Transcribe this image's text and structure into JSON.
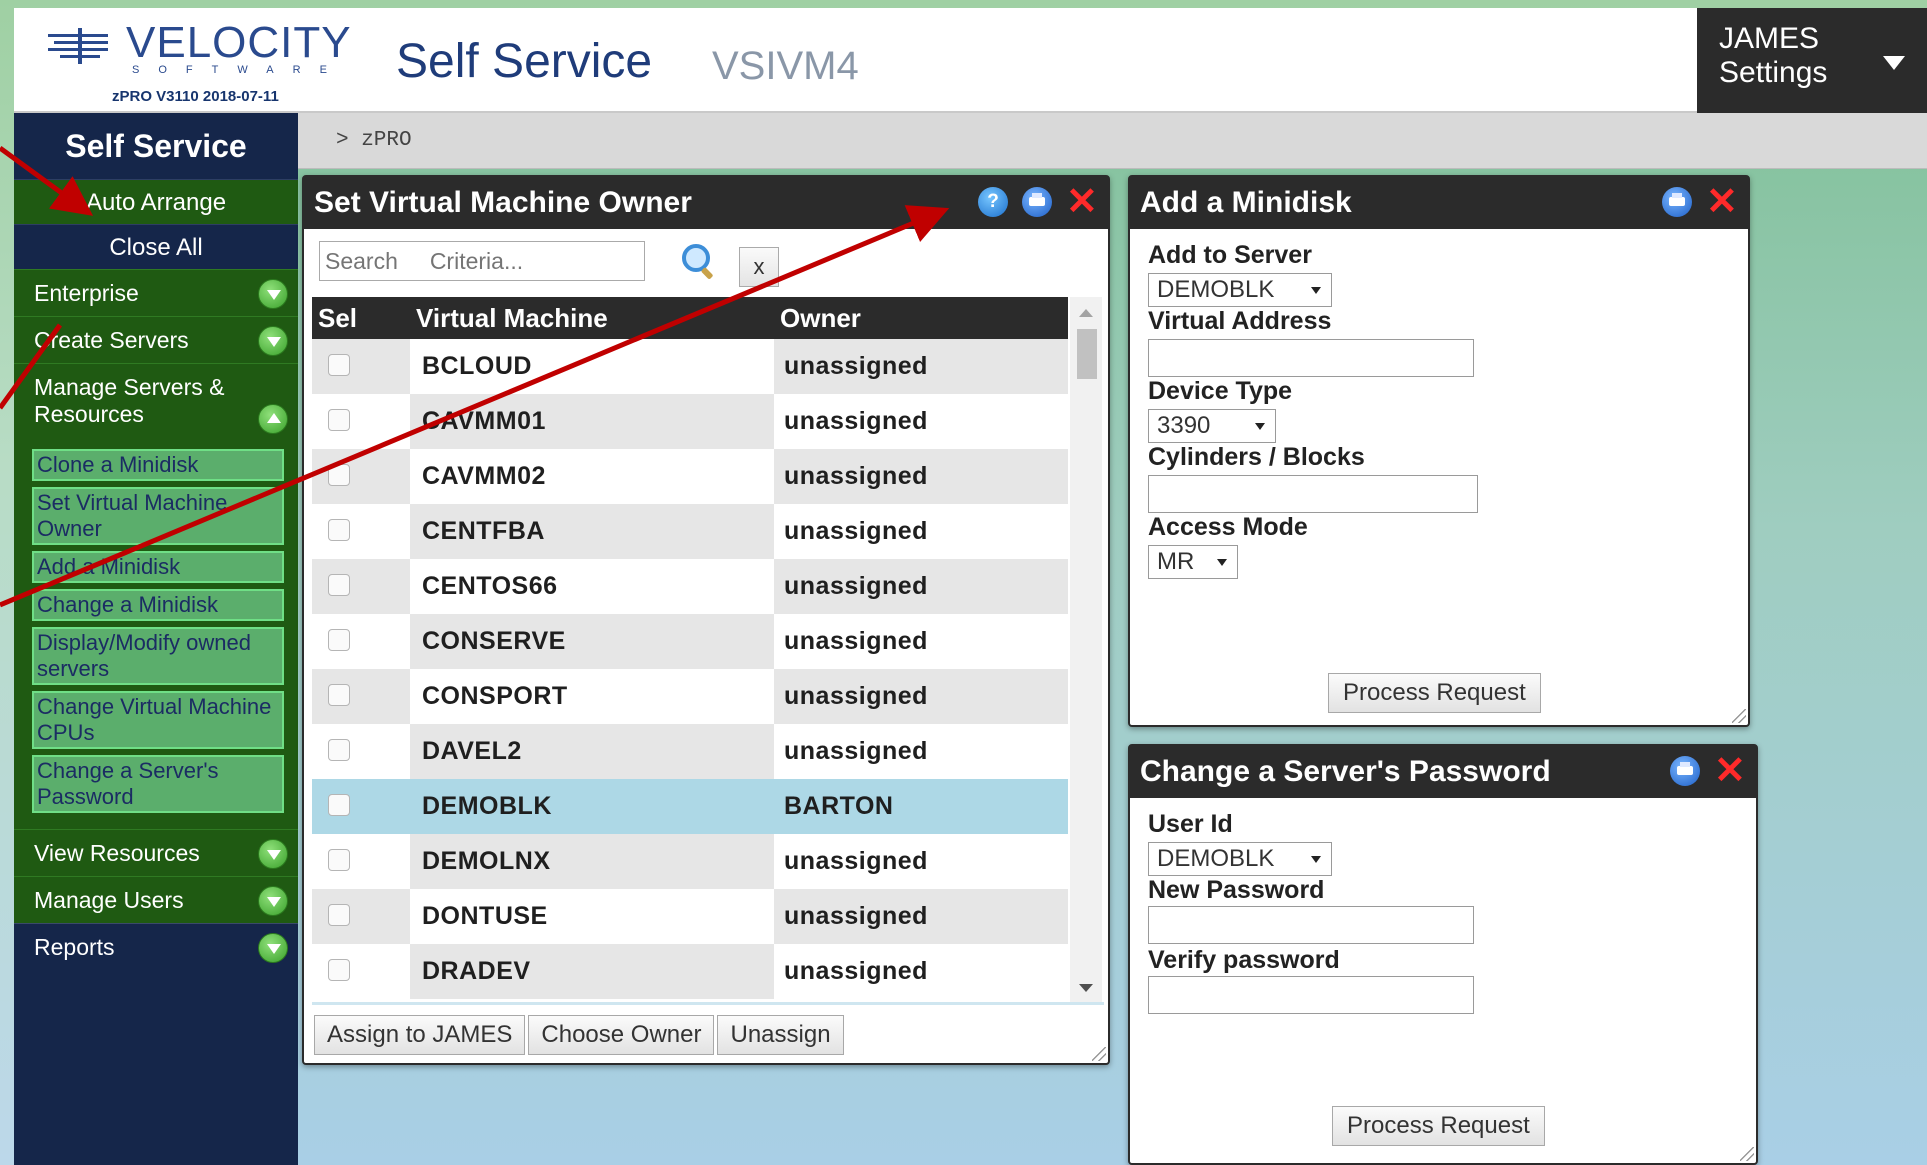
{
  "header": {
    "logo_text": "VELOCITY",
    "logo_sub": "SOFTWARE",
    "version": "zPRO V3110 2018-07-11",
    "title": "Self Service",
    "host": "VSIVM4",
    "user": "JAMES",
    "settings": "Settings"
  },
  "breadcrumb": {
    "path": "> zPRO"
  },
  "sidebar": {
    "title": "Self Service",
    "auto_arrange": "Auto Arrange",
    "close_all": "Close All",
    "sections": {
      "enterprise": "Enterprise",
      "create_servers": "Create Servers",
      "manage_servers": "Manage Servers & Resources",
      "view_resources": "View Resources",
      "manage_users": "Manage Users",
      "reports": "Reports"
    },
    "sub_items": [
      "Clone a Minidisk",
      "Set Virtual Machine Owner",
      "Add a Minidisk",
      "Change a Minidisk",
      "Display/Modify owned servers",
      "Change Virtual Machine CPUs",
      "Change a Server's Password"
    ]
  },
  "owner_panel": {
    "title": "Set Virtual Machine Owner",
    "search_placeholder": "Search     Criteria...",
    "clear_label": "x",
    "columns": {
      "sel": "Sel",
      "vm": "Virtual Machine",
      "owner": "Owner"
    },
    "rows": [
      {
        "vm": "BCLOUD",
        "owner": "unassigned"
      },
      {
        "vm": "CAVMM01",
        "owner": "unassigned"
      },
      {
        "vm": "CAVMM02",
        "owner": "unassigned"
      },
      {
        "vm": "CENTFBA",
        "owner": "unassigned"
      },
      {
        "vm": "CENTOS66",
        "owner": "unassigned"
      },
      {
        "vm": "CONSERVE",
        "owner": "unassigned"
      },
      {
        "vm": "CONSPORT",
        "owner": "unassigned"
      },
      {
        "vm": "DAVEL2",
        "owner": "unassigned"
      },
      {
        "vm": "DEMOBLK",
        "owner": "BARTON"
      },
      {
        "vm": "DEMOLNX",
        "owner": "unassigned"
      },
      {
        "vm": "DONTUSE",
        "owner": "unassigned"
      },
      {
        "vm": "DRADEV",
        "owner": "unassigned"
      }
    ],
    "buttons": {
      "assign": "Assign to JAMES",
      "choose": "Choose Owner",
      "unassign": "Unassign"
    }
  },
  "minidisk_panel": {
    "title": "Add a Minidisk",
    "add_to_server_label": "Add to Server",
    "add_to_server_value": "DEMOBLK",
    "virtual_address_label": "Virtual Address",
    "device_type_label": "Device Type",
    "device_type_value": "3390",
    "cyl_blocks_label": "Cylinders / Blocks",
    "access_mode_label": "Access Mode",
    "access_mode_value": "MR",
    "process": "Process Request"
  },
  "password_panel": {
    "title": "Change a Server's Password",
    "userid_label": "User Id",
    "userid_value": "DEMOBLK",
    "new_password_label": "New Password",
    "verify_label": "Verify password",
    "process": "Process Request"
  },
  "colors": {
    "sidebar_bg": "#15264a",
    "sidebar_green": "#1f5a12",
    "panel_header": "#2b2b2b",
    "selected_row": "#add8e6",
    "annotation_arrow": "#c00000"
  }
}
